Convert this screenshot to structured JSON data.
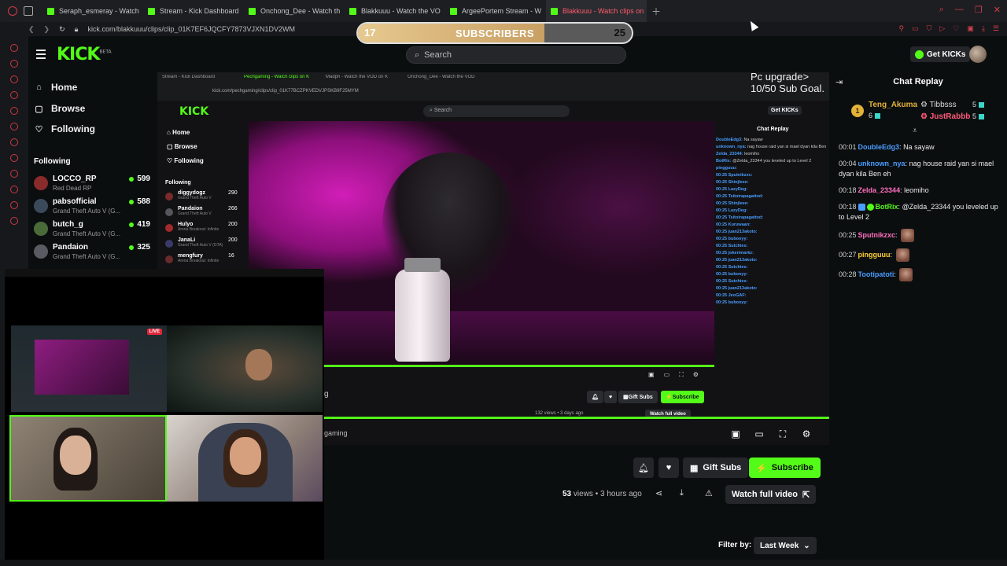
{
  "browser": {
    "tabs": [
      {
        "title": "Seraph_esmeray - Watch",
        "active": false
      },
      {
        "title": "Stream - Kick Dashboard",
        "active": false
      },
      {
        "title": "Onchong_Dee - Watch th",
        "active": false
      },
      {
        "title": "Blakkuuu - Watch the VO",
        "active": false
      },
      {
        "title": "ArgeePortem Stream - W",
        "active": false
      },
      {
        "title": "Blakkuuu - Watch clips on",
        "active": true
      }
    ],
    "url": "kick.com/blakkuuu/clips/clip_01K7EF6JQCFY7873VJXN1DV2WM"
  },
  "sub_goal": {
    "current": "17",
    "label": "SUBSCRIBERS",
    "target": "25",
    "progress": 0.68
  },
  "header": {
    "logo": "KICK",
    "logo_tag": "BETA",
    "search_placeholder": "Search",
    "get_kicks": "Get KICKs"
  },
  "sidebar": {
    "nav": [
      {
        "label": "Home",
        "icon": "home-icon"
      },
      {
        "label": "Browse",
        "icon": "browse-icon"
      },
      {
        "label": "Following",
        "icon": "heart-icon"
      }
    ],
    "following_title": "Following",
    "following": [
      {
        "name": "LOCCO_RP",
        "game": "Red Dead RP",
        "viewers": "599",
        "avatar_color": "#8a2b2b"
      },
      {
        "name": "pabsofficial",
        "game": "Grand Theft Auto V (G...",
        "viewers": "588",
        "avatar_color": "#3a4a5a"
      },
      {
        "name": "butch_g",
        "game": "Grand Theft Auto V (G...",
        "viewers": "419",
        "avatar_color": "#4a6a3a"
      },
      {
        "name": "Pandaion",
        "game": "Grand Theft Auto V (G...",
        "viewers": "325",
        "avatar_color": "#5a5a62"
      }
    ]
  },
  "nested": {
    "tabs": [
      "Stream - Kick Dashboard",
      "Pechgaming - Watch clips on K",
      "Madph - Watch the VOD on K",
      "Onchong_Dee - Watch the VOD"
    ],
    "url": "kick.com/pechgaming/clips/clip_01K77BCZPKVEDVJPSKB9F25MYM",
    "logo": "KICK",
    "search": "Search",
    "get_kicks": "Get KICKs",
    "nav": [
      "Home",
      "Browse",
      "Following"
    ],
    "following_title": "Following",
    "following": [
      {
        "name": "diggydogz",
        "game": "Grand Theft Auto V",
        "viewers": "290"
      },
      {
        "name": "Pandaion",
        "game": "Grand Theft Auto V",
        "viewers": "266"
      },
      {
        "name": "Hulyo",
        "game": "Arena Breakout: Infinite",
        "viewers": "200"
      },
      {
        "name": "JanaLi",
        "game": "Grand Theft Auto V (GTA)",
        "viewers": "200"
      },
      {
        "name": "mengfury",
        "game": "Arena Breakout: Infinite",
        "viewers": "16"
      }
    ],
    "chat_title": "Chat Replay",
    "chat_lines": [
      {
        "user": "DoubleEdg3",
        "text": "Na sayaw"
      },
      {
        "user": "unknown_nya",
        "text": "nag house raid yan si mael dyan kila Ben eh"
      },
      {
        "user": "Zelda_23344",
        "text": "leomiho"
      },
      {
        "user": "BotRix",
        "text": "@Zelda_23344 you leveled up to Level 2"
      },
      {
        "user": "pingguuu",
        "text": ""
      },
      {
        "user": "00:25 Sputnikzxc",
        "text": ""
      },
      {
        "user": "00:25 Shinjleee",
        "text": ""
      },
      {
        "user": "00:25 LazyDeg",
        "text": ""
      },
      {
        "user": "00:25 Tsitoirapagattod",
        "text": ""
      },
      {
        "user": "00:25 Shinjleee",
        "text": ""
      },
      {
        "user": "00:25 LazyDeg",
        "text": ""
      },
      {
        "user": "00:25 Tsitoirapagattod",
        "text": ""
      },
      {
        "user": "00:25 Kuruwaan",
        "text": ""
      },
      {
        "user": "00:25 juan213akoto",
        "text": ""
      },
      {
        "user": "00:25 bubooyy",
        "text": ""
      },
      {
        "user": "00:25 Sutchies",
        "text": ""
      },
      {
        "user": "00:25 jokerimarkz",
        "text": ""
      },
      {
        "user": "00:25 juan213akoto",
        "text": ""
      },
      {
        "user": "00:25 Sutchies",
        "text": ""
      },
      {
        "user": "00:25 bubooyy",
        "text": ""
      },
      {
        "user": "00:25 Sutchies",
        "text": ""
      },
      {
        "user": "00:25 juan213akoto",
        "text": ""
      },
      {
        "user": "00:25 JeoGAF",
        "text": ""
      },
      {
        "user": "00:25 bubooyy",
        "text": ""
      }
    ],
    "subscribe": "Subscribe",
    "gift_subs": "Gift Subs",
    "meta": "132 views • 3 days ago",
    "watch_full": "Watch full video",
    "channel_fragment": "g",
    "channel_sub": "gaming"
  },
  "overlay": {
    "line1": "Pc upgrade>",
    "line2": "10/50 Sub Goal."
  },
  "chat": {
    "title": "Chat Replay",
    "leaderboard": [
      {
        "rank": "1",
        "name": "Teng_Akuma",
        "value": "6",
        "color": "#e2b23a"
      },
      {
        "name": "Tibbsss",
        "value": "5"
      },
      {
        "name": "JustRabbb",
        "value": "5",
        "color": "#ff5a7a"
      }
    ],
    "messages": [
      {
        "time": "00:01",
        "user": "DoubleEdg3",
        "color": "#4a9cff",
        "text": "Na sayaw",
        "emote": false
      },
      {
        "time": "00:04",
        "user": "unknown_nya",
        "color": "#4a9cff",
        "text": "nag house raid yan si mael dyan kila Ben eh",
        "emote": false
      },
      {
        "time": "00:18",
        "user": "Zelda_23344",
        "color": "#ff6fbf",
        "text": "leomiho",
        "emote": false
      },
      {
        "time": "00:18",
        "user": "BotRix",
        "color": "#53fc18",
        "text": "@Zelda_23344 you leveled up to Level 2",
        "emote": false
      },
      {
        "time": "00:25",
        "user": "Sputnikzxc",
        "color": "#ff6fbf",
        "text": "",
        "emote": true
      },
      {
        "time": "00:27",
        "user": "pingguuu",
        "color": "#ffd23a",
        "text": "",
        "emote": true
      },
      {
        "time": "00:28",
        "user": "Tootipatoti",
        "color": "#4a9cff",
        "text": "",
        "emote": true
      }
    ]
  },
  "actions": {
    "channel_fragment": "g",
    "channel_sub": "gaming",
    "gift_subs": "Gift Subs",
    "subscribe": "Subscribe",
    "views": "53",
    "views_label": "views",
    "time_ago": "3 hours ago",
    "watch_full": "Watch full video",
    "filter_label": "Filter by:",
    "filter_value": "Last Week"
  },
  "colors": {
    "kick_green": "#53fc18",
    "bg": "#0b0e0f",
    "surface": "#24262a",
    "active_tab_text": "#ff5a6b"
  }
}
